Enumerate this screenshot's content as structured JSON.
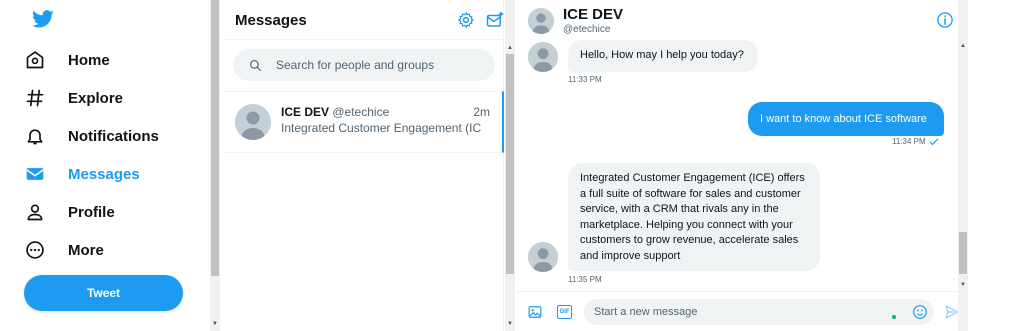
{
  "nav": {
    "items": [
      {
        "label": "Home",
        "icon": "home-icon"
      },
      {
        "label": "Explore",
        "icon": "hashtag-icon"
      },
      {
        "label": "Notifications",
        "icon": "bell-icon"
      },
      {
        "label": "Messages",
        "icon": "envelope-icon",
        "active": true
      },
      {
        "label": "Profile",
        "icon": "person-icon"
      },
      {
        "label": "More",
        "icon": "more-circle-icon"
      }
    ],
    "tweet_label": "Tweet"
  },
  "colors": {
    "accent": "#1d9bf0",
    "text": "#0f1419",
    "muted": "#536471",
    "bubble": "#eff3f4"
  },
  "messages_panel": {
    "title": "Messages",
    "search_placeholder": "Search for people and groups",
    "conversations": [
      {
        "name": "ICE DEV",
        "handle": "@etechice",
        "time": "2m",
        "preview": "Integrated Customer Engagement (IC..."
      }
    ]
  },
  "chat": {
    "name": "ICE DEV",
    "handle": "@etechice",
    "messages": [
      {
        "direction": "in",
        "text": "Hello, How may I help you today?",
        "time": "11:33 PM"
      },
      {
        "direction": "out",
        "text": "I want to know about ICE software",
        "time": "11:34 PM"
      },
      {
        "direction": "in",
        "text": "Integrated Customer Engagement (ICE) offers a full suite of software for sales and customer service, with a CRM that rivals any in the marketplace. Helping you connect with your customers to grow revenue, accelerate sales and improve support",
        "time": "11:35 PM"
      }
    ],
    "composer_placeholder": "Start a new message",
    "gif_label": "GIF"
  }
}
